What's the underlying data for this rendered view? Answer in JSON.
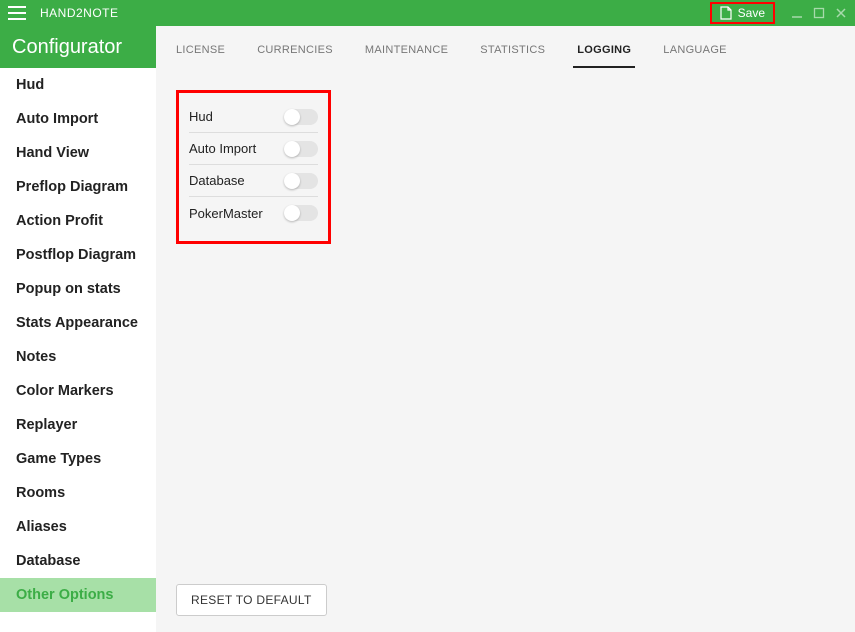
{
  "titlebar": {
    "app_name": "HAND2NOTE",
    "save_label": "Save"
  },
  "subheader": {
    "title": "Configurator"
  },
  "tabs": [
    {
      "label": "LICENSE",
      "active": false
    },
    {
      "label": "CURRENCIES",
      "active": false
    },
    {
      "label": "MAINTENANCE",
      "active": false
    },
    {
      "label": "STATISTICS",
      "active": false
    },
    {
      "label": "LOGGING",
      "active": true
    },
    {
      "label": "LANGUAGE",
      "active": false
    }
  ],
  "sidebar": {
    "items": [
      {
        "label": "Hud",
        "active": false
      },
      {
        "label": "Auto Import",
        "active": false
      },
      {
        "label": "Hand View",
        "active": false
      },
      {
        "label": "Preflop Diagram",
        "active": false
      },
      {
        "label": "Action Profit",
        "active": false
      },
      {
        "label": "Postflop Diagram",
        "active": false
      },
      {
        "label": "Popup on stats",
        "active": false
      },
      {
        "label": "Stats Appearance",
        "active": false
      },
      {
        "label": "Notes",
        "active": false
      },
      {
        "label": "Color Markers",
        "active": false
      },
      {
        "label": "Replayer",
        "active": false
      },
      {
        "label": "Game Types",
        "active": false
      },
      {
        "label": "Rooms",
        "active": false
      },
      {
        "label": "Aliases",
        "active": false
      },
      {
        "label": "Database",
        "active": false
      },
      {
        "label": "Other Options",
        "active": true
      }
    ]
  },
  "logging": {
    "toggles": [
      {
        "label": "Hud",
        "on": false
      },
      {
        "label": "Auto Import",
        "on": false
      },
      {
        "label": "Database",
        "on": false
      },
      {
        "label": "PokerMaster",
        "on": false
      }
    ]
  },
  "buttons": {
    "reset": "RESET TO DEFAULT"
  },
  "highlights": {
    "save_button": true,
    "toggle_panel": true
  }
}
